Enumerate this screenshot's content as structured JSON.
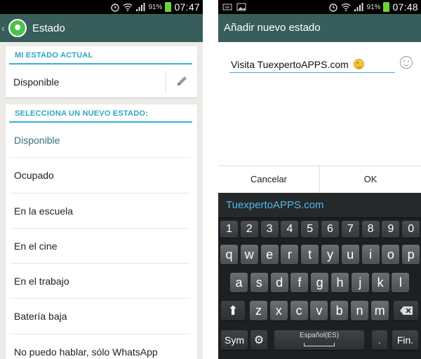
{
  "left": {
    "status_bar": {
      "battery_pct": "91%",
      "time": "07:47"
    },
    "header": {
      "back_glyph": "‹",
      "title": "Estado",
      "logo_icon": "whatsapp-logo"
    },
    "current_section": {
      "title": "MI ESTADO ACTUAL",
      "value": "Disponible",
      "edit_icon": "pencil-icon"
    },
    "new_section": {
      "title": "SELECCIONA UN NUEVO ESTADO:",
      "items": [
        "Disponible",
        "Ocupado",
        "En la escuela",
        "En el cine",
        "En el trabajo",
        "Batería baja",
        "No puedo hablar, sólo WhatsApp"
      ],
      "selected_index": 0
    }
  },
  "right": {
    "status_bar": {
      "battery_pct": "91%",
      "time": "07:48"
    },
    "dialog": {
      "title": "Añadir nuevo estado",
      "input_value": "Visita TuexpertoAPPS.com",
      "cancel_label": "Cancelar",
      "ok_label": "OK"
    },
    "keyboard": {
      "suggestion": "TuexpertoAPPS.com",
      "numbers": [
        "1",
        "2",
        "3",
        "4",
        "5",
        "6",
        "7",
        "8",
        "9",
        "0"
      ],
      "row1": [
        "q",
        "w",
        "e",
        "r",
        "t",
        "y",
        "u",
        "i",
        "o",
        "p"
      ],
      "row2": [
        "a",
        "s",
        "d",
        "f",
        "g",
        "h",
        "j",
        "k",
        "l"
      ],
      "row3": [
        "z",
        "x",
        "c",
        "v",
        "b",
        "n",
        "m"
      ],
      "sym_label": "Sym",
      "space_label": "Español(ES)",
      "period_label": ".",
      "enter_label": "Fin."
    }
  },
  "colors": {
    "header": "#385e5b",
    "accent": "#35b1d2",
    "keyboard_bg": "#1d1f22",
    "suggestion": "#4fb9e6"
  }
}
